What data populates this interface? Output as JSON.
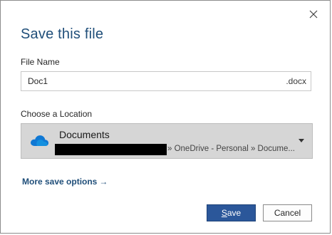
{
  "dialog": {
    "title": "Save this file",
    "close_icon": "close-icon"
  },
  "file_name": {
    "label": "File Name",
    "value": "Doc1",
    "extension": ".docx"
  },
  "location": {
    "label": "Choose a Location",
    "icon": "onedrive-cloud-icon",
    "name": "Documents",
    "path": "» OneDrive - Personal » Docume..."
  },
  "more_options": {
    "label": "More save options",
    "arrow": "→"
  },
  "buttons": {
    "save_first": "S",
    "save_rest": "ave",
    "cancel": "Cancel"
  },
  "colors": {
    "accent": "#2b579a",
    "title": "#1f4e79",
    "onedrive": "#0364b8"
  }
}
